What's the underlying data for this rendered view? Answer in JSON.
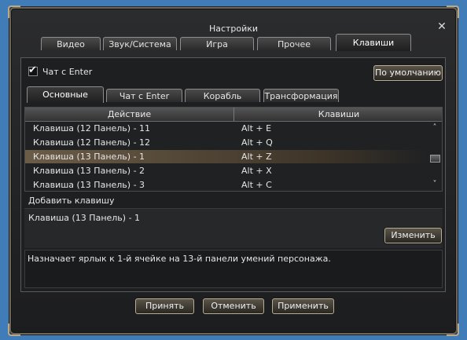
{
  "window": {
    "title": "Настройки",
    "close_glyph": "✕"
  },
  "tabs": [
    {
      "label": "Видео",
      "active": false
    },
    {
      "label": "Звук/Система",
      "active": false
    },
    {
      "label": "Игра",
      "active": false
    },
    {
      "label": "Прочее",
      "active": false
    },
    {
      "label": "Клавиши",
      "active": true
    }
  ],
  "chat_enter": {
    "label": "Чат с Enter",
    "checked": true,
    "check_glyph": "✔"
  },
  "default_button": "По умолчанию",
  "subtabs": [
    {
      "label": "Основные",
      "active": true
    },
    {
      "label": "Чат с Enter",
      "active": false
    },
    {
      "label": "Корабль",
      "active": false
    },
    {
      "label": "Трансформация",
      "active": false
    }
  ],
  "table": {
    "headers": [
      "Действие",
      "Клавиши"
    ],
    "rows": [
      {
        "action": "Клавиша (12 Панель) - 11",
        "keys": "Alt + E",
        "selected": false
      },
      {
        "action": "Клавиша (12 Панель) - 12",
        "keys": "Alt + Q",
        "selected": false
      },
      {
        "action": "Клавиша (13 Панель) - 1",
        "keys": "Alt + Z",
        "selected": true
      },
      {
        "action": "Клавиша (13 Панель) - 2",
        "keys": "Alt + X",
        "selected": false
      },
      {
        "action": "Клавиша (13 Панель) - 3",
        "keys": "Alt + C",
        "selected": false
      }
    ],
    "scroll_up_glyph": "˄",
    "scroll_down_glyph": "˅"
  },
  "add_key_label": "Добавить клавишу",
  "selected_key": "Клавиша (13 Панель) - 1",
  "change_button": "Изменить",
  "description": "Назначает ярлык к 1-й ячейке на 13-й панели умений персонажа.",
  "footer": {
    "accept": "Принять",
    "cancel": "Отменить",
    "apply": "Применить"
  }
}
